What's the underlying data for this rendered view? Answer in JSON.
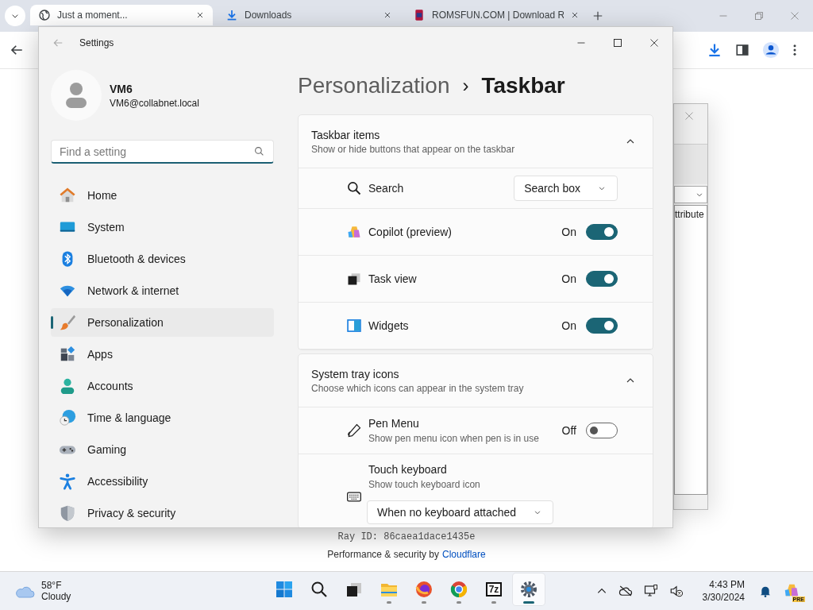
{
  "browser": {
    "tabs": [
      {
        "title": "Just a moment...",
        "kind": "globe",
        "selected": true
      },
      {
        "title": "Downloads",
        "kind": "download",
        "selected": false
      },
      {
        "title": "ROMSFUN.COM | Download R",
        "kind": "site",
        "selected": false
      }
    ]
  },
  "background_page": {
    "dialog_text": "ttribute",
    "ray_id": "Ray ID: 86caea1dace1435e",
    "footer": "Performance & security by",
    "footer_link": "Cloudflare"
  },
  "settings": {
    "title": "Settings",
    "user_name": "VM6",
    "user_email": "VM6@collabnet.local",
    "search": {
      "placeholder": "Find a setting"
    },
    "nav": [
      {
        "label": "Home",
        "kind": "home",
        "selected": false
      },
      {
        "label": "System",
        "kind": "system",
        "selected": false
      },
      {
        "label": "Bluetooth & devices",
        "kind": "bluetooth",
        "selected": false
      },
      {
        "label": "Network & internet",
        "kind": "network",
        "selected": false
      },
      {
        "label": "Personalization",
        "kind": "personalization",
        "selected": true
      },
      {
        "label": "Apps",
        "kind": "apps",
        "selected": false
      },
      {
        "label": "Accounts",
        "kind": "accounts",
        "selected": false
      },
      {
        "label": "Time & language",
        "kind": "time",
        "selected": false
      },
      {
        "label": "Gaming",
        "kind": "gaming",
        "selected": false
      },
      {
        "label": "Accessibility",
        "kind": "accessibility",
        "selected": false
      },
      {
        "label": "Privacy & security",
        "kind": "privacy",
        "selected": false
      }
    ],
    "breadcrumb": {
      "parent": "Personalization",
      "separator": "›",
      "current": "Taskbar"
    },
    "sections": [
      {
        "title": "Taskbar items",
        "subtitle": "Show or hide buttons that appear on the taskbar",
        "expanded": true,
        "rows": [
          {
            "kind": "dropdown",
            "label": "Search",
            "value": "Search box"
          },
          {
            "kind": "toggle",
            "label": "Copilot (preview)",
            "state": "On",
            "on": true
          },
          {
            "kind": "toggle",
            "label": "Task view",
            "state": "On",
            "on": true
          },
          {
            "kind": "toggle",
            "label": "Widgets",
            "state": "On",
            "on": true
          }
        ]
      },
      {
        "title": "System tray icons",
        "subtitle": "Choose which icons can appear in the system tray",
        "expanded": true,
        "rows": [
          {
            "kind": "toggle",
            "label": "Pen Menu",
            "description": "Show pen menu icon when pen is in use",
            "state": "Off",
            "on": false
          },
          {
            "kind": "dropdown_below",
            "label": "Touch keyboard",
            "description": "Show touch keyboard icon",
            "value": "When no keyboard attached"
          }
        ]
      }
    ]
  },
  "taskbar": {
    "weather": {
      "temperature": "58°F",
      "condition": "Cloudy"
    },
    "apps": [
      {
        "kind": "start",
        "running": false,
        "active": false
      },
      {
        "kind": "search",
        "running": false,
        "active": false
      },
      {
        "kind": "taskview",
        "running": false,
        "active": false
      },
      {
        "kind": "files",
        "running": true,
        "active": false
      },
      {
        "kind": "firefox",
        "running": true,
        "active": false
      },
      {
        "kind": "chrome",
        "running": true,
        "active": false
      },
      {
        "kind": "archiver",
        "label": "7z",
        "running": true,
        "active": false
      },
      {
        "kind": "settings",
        "running": true,
        "active": true
      }
    ],
    "time": "4:43 PM",
    "date": "3/30/2024",
    "copilot_badge": "PRE"
  }
}
